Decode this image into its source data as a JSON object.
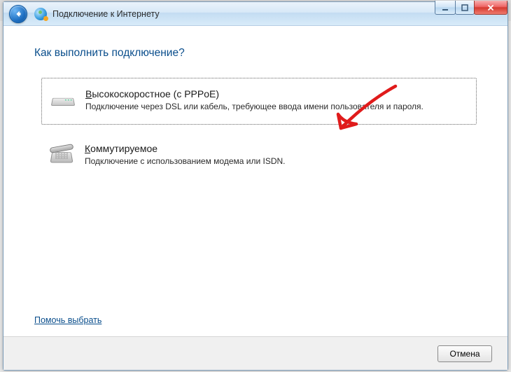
{
  "window": {
    "title": "Подключение к Интернету"
  },
  "main": {
    "heading": "Как выполнить подключение?",
    "options": [
      {
        "title_text": "Высокоскоростное (с PPPoE)",
        "title_ul_index": 0,
        "desc": "Подключение через DSL или кабель, требующее ввода имени пользователя и пароля."
      },
      {
        "title_text": "Коммутируемое",
        "title_ul_index": 0,
        "desc": "Подключение с использованием модема или ISDN."
      }
    ],
    "help_link": "Помочь выбрать"
  },
  "footer": {
    "cancel_label": "Отмена"
  },
  "annotation": {
    "arrow_color": "#e01b1b"
  }
}
